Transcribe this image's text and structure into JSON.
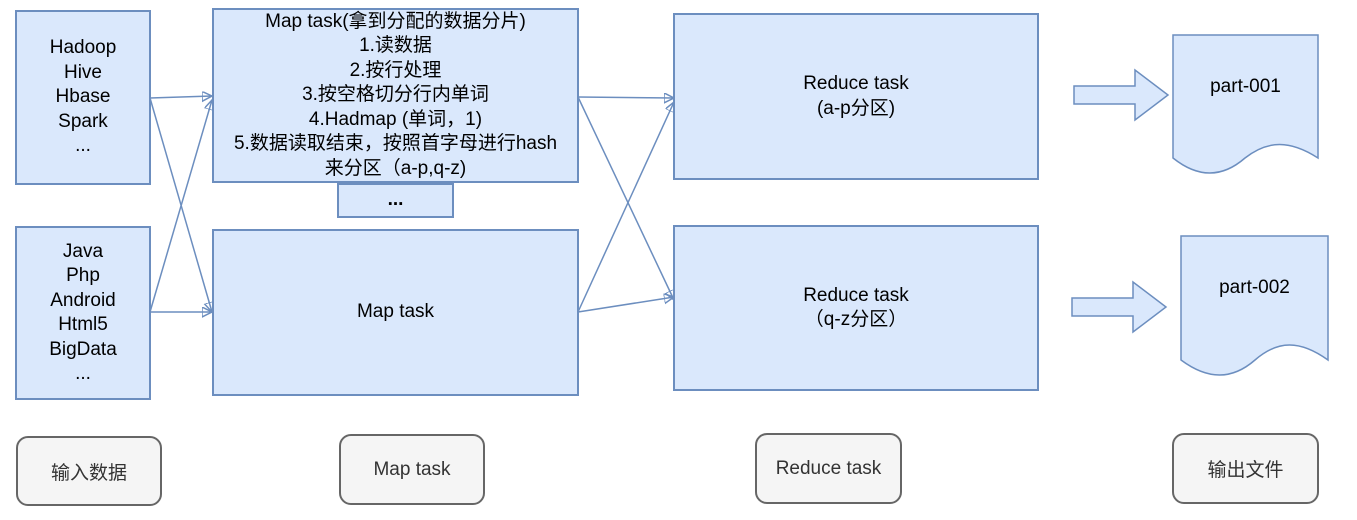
{
  "input_box_1": {
    "lines": [
      "Hadoop",
      "Hive",
      "Hbase",
      "Spark",
      "..."
    ]
  },
  "input_box_2": {
    "lines": [
      "Java",
      "Php",
      "Android",
      "Html5",
      "BigData",
      "..."
    ]
  },
  "map_task_1": {
    "lines": [
      "Map task(拿到分配的数据分片)",
      "1.读数据",
      "2.按行处理",
      "3.按空格切分行内单词",
      "4.Hadmap (单词，1)",
      "5.数据读取结束，按照首字母进行hash",
      "来分区（a-p,q-z)"
    ]
  },
  "map_ellipsis": "...",
  "map_task_2": {
    "title": "Map task"
  },
  "reduce_task_1": {
    "title": "Reduce task",
    "partition": "(a-p分区)"
  },
  "reduce_task_2": {
    "title": "Reduce task",
    "partition": "（q-z分区）"
  },
  "output_file_1": "part-001",
  "output_file_2": "part-002",
  "stage_labels": {
    "input": "输入数据",
    "map": "Map task",
    "reduce": "Reduce task",
    "output": "输出文件"
  },
  "colors": {
    "box_fill": "#dae8fc",
    "box_stroke": "#6c8ebf",
    "label_fill": "#f5f5f5",
    "label_stroke": "#666666"
  }
}
